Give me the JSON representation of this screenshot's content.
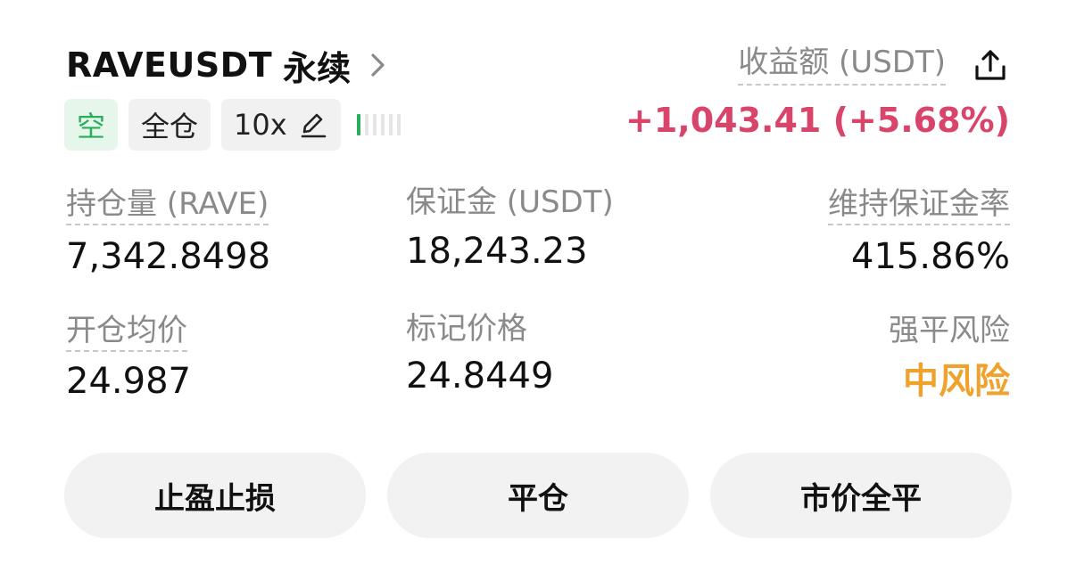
{
  "header": {
    "symbol": "RAVEUSDT",
    "contract_type": "永续",
    "tags": {
      "side": "空",
      "margin_mode": "全仓",
      "leverage": "10x"
    },
    "pnl_label": "收益额 (USDT)",
    "pnl_value": "+1,043.41 (+5.68%)"
  },
  "stats": {
    "position_size": {
      "label": "持仓量 (RAVE)",
      "value": "7,342.8498"
    },
    "margin": {
      "label": "保证金 (USDT)",
      "value": "18,243.23"
    },
    "maint_margin_ratio": {
      "label": "维持保证金率",
      "value": "415.86%"
    },
    "entry_price": {
      "label": "开仓均价",
      "value": "24.987"
    },
    "mark_price": {
      "label": "标记价格",
      "value": "24.8449"
    },
    "liq_risk": {
      "label": "强平风险",
      "value": "中风险"
    }
  },
  "risk_level": {
    "filled_bars": 1,
    "total_bars": 6
  },
  "actions": {
    "tp_sl": "止盈止损",
    "close": "平仓",
    "market_close_all": "市价全平"
  },
  "colors": {
    "profit": "#d9456a",
    "short_green": "#2aae5c",
    "medium_risk": "#efa22c"
  }
}
